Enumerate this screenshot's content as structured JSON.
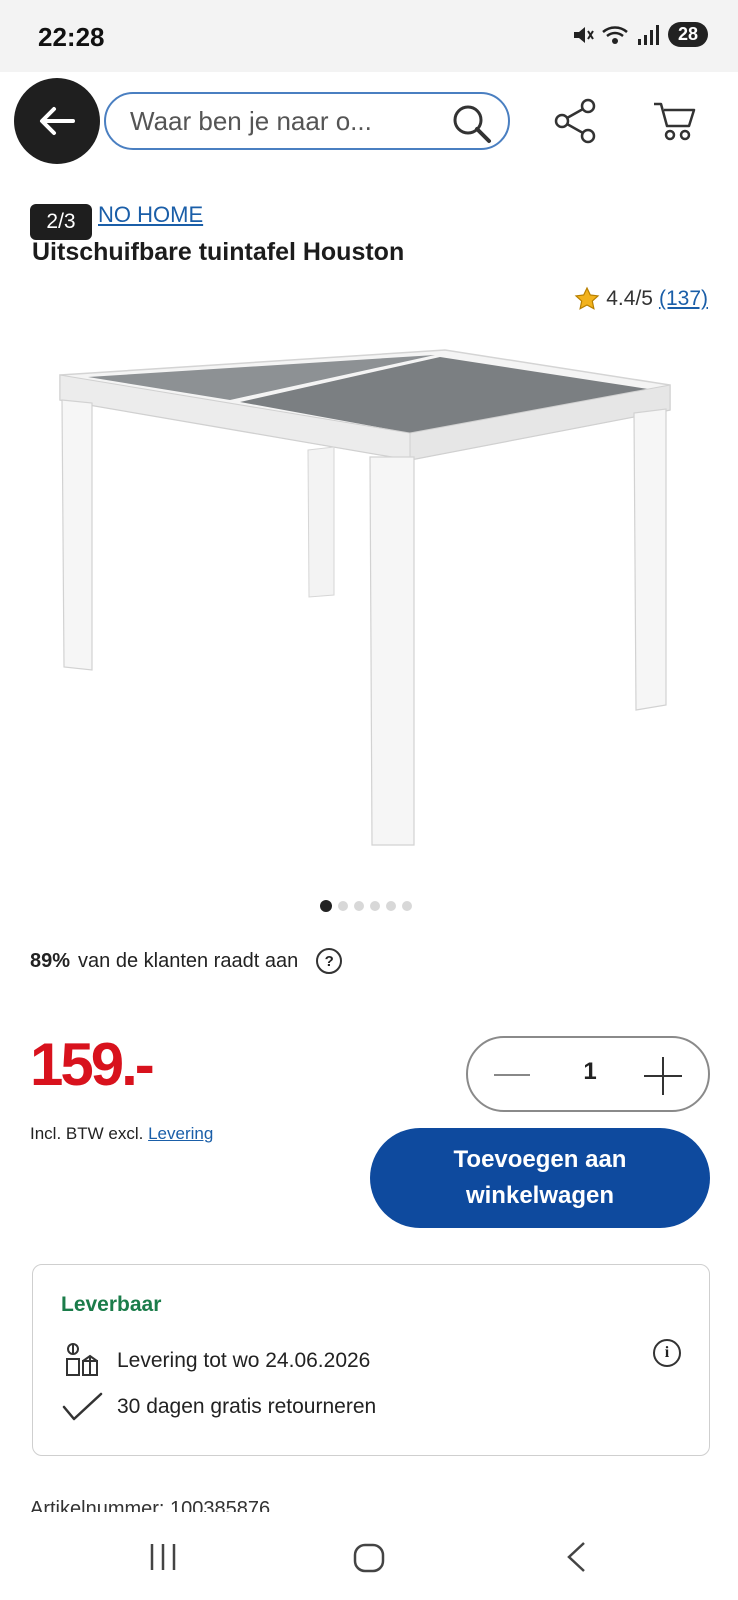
{
  "status_bar": {
    "time": "22:28",
    "battery": "28"
  },
  "search": {
    "placeholder": "Waar ben je naar o..."
  },
  "product": {
    "brand": "LIVARNO HOME",
    "brand_visible": "NO HOME",
    "image_counter": "2/3",
    "title": "Uitschuifbare tuintafel Houston",
    "rating": "4.4/5",
    "rating_count": "(137)",
    "image_dots": 6,
    "active_dot": 0
  },
  "recommendation": {
    "percent": "89%",
    "text": "van de klanten raadt aan",
    "help": "?"
  },
  "purchase": {
    "price": "159.-",
    "quantity": "1",
    "vat_text": "Incl. BTW excl.",
    "vat_link": "Levering",
    "add_to_cart_line1": "Toevoegen aan",
    "add_to_cart_line2": "winkelwagen"
  },
  "delivery": {
    "status": "Leverbaar",
    "delivery_text": "Levering tot wo 24.06.2026",
    "returns_text": "30 dagen gratis retourneren",
    "info": "i"
  },
  "article": {
    "label": "Artikelnummer: 100385876"
  },
  "colors": {
    "price_red": "#d8121d",
    "button_blue": "#0e4a9e",
    "link_blue": "#1a5ea8",
    "available_green": "#1b7c4a"
  }
}
